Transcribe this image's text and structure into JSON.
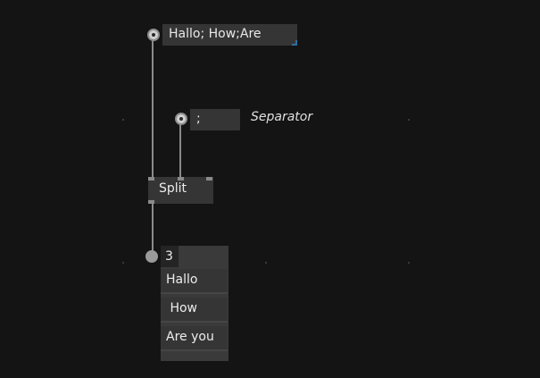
{
  "input_iobox": {
    "value": "Hallo; How;Are"
  },
  "separator_iobox": {
    "value": ";"
  },
  "separator_comment": "Separator",
  "split_node": {
    "label": "Split"
  },
  "output_spread": {
    "count": "3",
    "items": [
      "Hallo",
      " How",
      "Are you"
    ]
  },
  "colors": {
    "background": "#141414",
    "node_fill": "#353535",
    "link": "#8a8a8a",
    "resize_accent": "#2f6f9f"
  }
}
